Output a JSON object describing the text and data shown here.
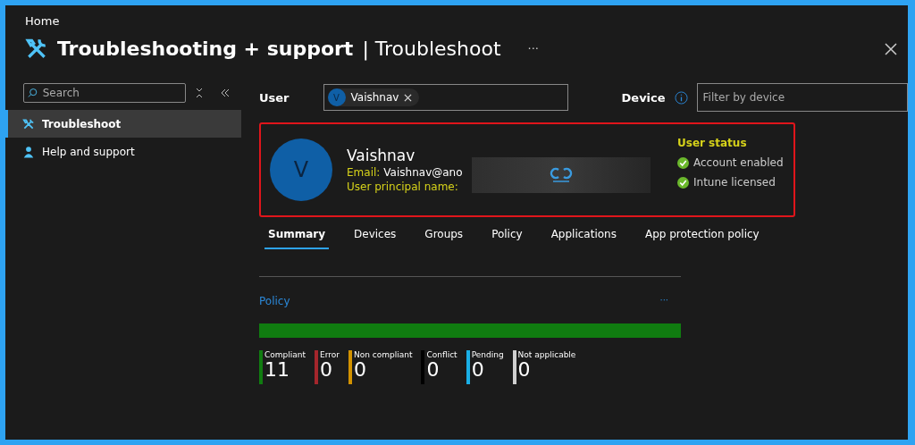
{
  "breadcrumb": "Home",
  "title": {
    "main": "Troubleshooting + support",
    "separator": "|",
    "sub": "Troubleshoot",
    "more": "···"
  },
  "sidebar": {
    "search": {
      "placeholder": "Search"
    },
    "items": [
      {
        "label": "Troubleshoot",
        "kind": "tools",
        "selected": true
      },
      {
        "label": "Help and support",
        "kind": "person",
        "selected": false
      }
    ]
  },
  "filters": {
    "user_label": "User",
    "user_chip": {
      "initial": "V",
      "name": "Vaishnav"
    },
    "device_label": "Device",
    "device_placeholder": "Filter by device"
  },
  "user_card": {
    "initial": "V",
    "name": "Vaishnav",
    "email_label": "Email:",
    "email": "Vaishnav@ano",
    "upn_label": "User principal name:",
    "status_title": "User status",
    "statuses": [
      {
        "label": "Account enabled",
        "ok": true
      },
      {
        "label": "Intune licensed",
        "ok": true
      }
    ]
  },
  "tabs": [
    {
      "label": "Summary",
      "selected": true
    },
    {
      "label": "Devices",
      "selected": false
    },
    {
      "label": "Groups",
      "selected": false
    },
    {
      "label": "Policy",
      "selected": false
    },
    {
      "label": "Applications",
      "selected": false
    },
    {
      "label": "App protection policy",
      "selected": false
    }
  ],
  "policy": {
    "title": "Policy",
    "more": "···",
    "bar": {
      "level": 1
    },
    "legend": [
      {
        "label": "Compliant",
        "value": "11",
        "color": "#107c10"
      },
      {
        "label": "Error",
        "value": "0",
        "color": "#a4262c"
      },
      {
        "label": "Non compliant",
        "value": "0",
        "color": "#d29200"
      },
      {
        "label": "Conflict",
        "value": "0",
        "color": "#000000"
      },
      {
        "label": "Pending",
        "value": "0",
        "color": "#1aafe6"
      },
      {
        "label": "Not applicable",
        "value": "0",
        "color": "#d0d0d0"
      }
    ]
  }
}
